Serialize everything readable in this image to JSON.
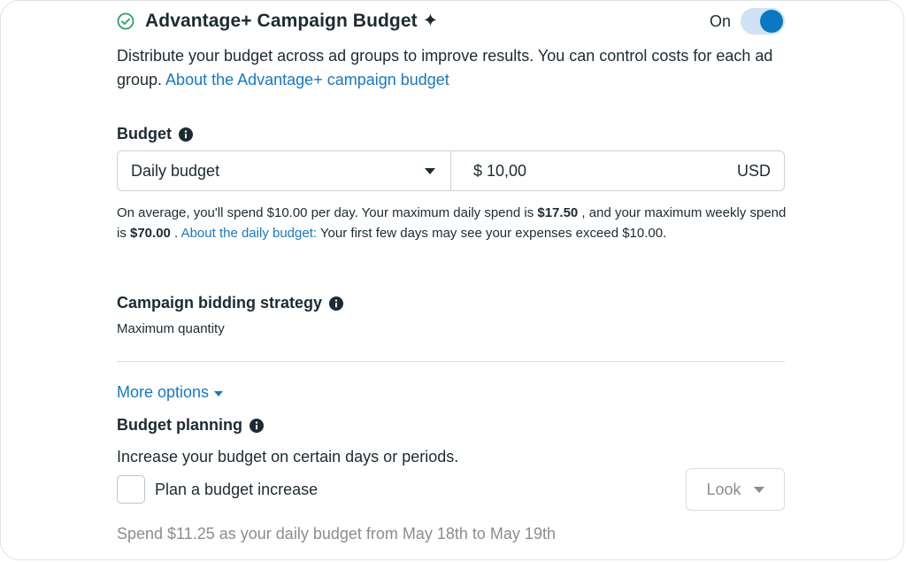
{
  "header": {
    "title": "Advantage+ Campaign Budget ✦",
    "toggle_label": "On",
    "toggle_on": true
  },
  "description": {
    "text": "Distribute your budget across ad groups to improve results. You can control costs for each ad group. ",
    "link": "About the Advantage+ campaign budget"
  },
  "budget": {
    "heading": "Budget",
    "type_selected": "Daily budget",
    "amount": "$ 10,00",
    "currency": "USD",
    "note": {
      "part1": "On average, you'll spend $10.00 per day. Your maximum daily spend is ",
      "max_daily": "$17.50",
      "part2": " , and your maximum weekly spend is ",
      "max_weekly": "$70.00",
      "part3": " . ",
      "link": "About the daily budget:",
      "part4": " Your first few days may see your expenses exceed $10.00."
    }
  },
  "bidding": {
    "heading": "Campaign bidding strategy",
    "value": "Maximum quantity"
  },
  "more_options": {
    "label": "More options"
  },
  "planning": {
    "heading": "Budget planning",
    "description": "Increase your budget on certain days or periods.",
    "checkbox_label": "Plan a budget increase",
    "look_label": "Look",
    "spend_text": "Spend $11.25 as your daily budget from May 18th to May 19th"
  },
  "colors": {
    "accent": "#0a78c2",
    "link": "#1877c9",
    "success": "#2f9e5f",
    "text": "#1c2b33",
    "muted": "#8a8d91"
  }
}
